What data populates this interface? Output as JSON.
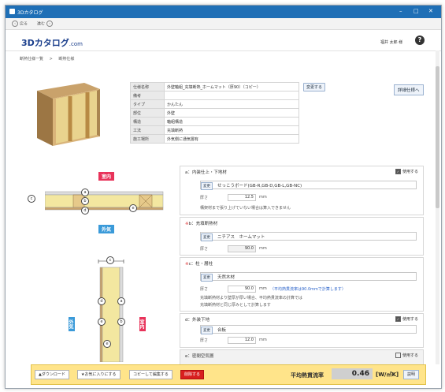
{
  "window": {
    "title": "3Dカタログ"
  },
  "nav": {
    "back": "戻る",
    "forward": "進む"
  },
  "header": {
    "logo_main": "3Dカタログ",
    "logo_com": ".com",
    "user": "福井 太郎 様",
    "help": "?"
  },
  "breadcrumb": {
    "items": [
      "断熱仕様一覧",
      ">",
      "断熱仕様"
    ]
  },
  "spec": {
    "rows": [
      {
        "k": "仕様名称",
        "v": "外壁軸組_充填断熱_ホームマット（厚90）（コピー）"
      },
      {
        "k": "備考",
        "v": ""
      },
      {
        "k": "タイプ",
        "v": "かんたん"
      },
      {
        "k": "部位",
        "v": "外壁"
      },
      {
        "k": "構造",
        "v": "軸組構造"
      },
      {
        "k": "工法",
        "v": "充填断熱"
      },
      {
        "k": "施工場所",
        "v": "外気側に通気層有"
      }
    ],
    "change_btn": "変更する",
    "detail_btn": "詳細仕様へ"
  },
  "diagram": {
    "indoor": "室内",
    "outdoor": "外気",
    "labels": {
      "a": "a",
      "b": "b",
      "c": "c",
      "d": "d",
      "e": "e"
    }
  },
  "layers": [
    {
      "hd": "a：内装仕上・下地材",
      "use": "使用する",
      "checked": true,
      "change": "変更",
      "material": "せっこうボード(GB-R,GB-D,GB-L,GB-NC)",
      "thick_label": "厚さ",
      "thickness": "12.5",
      "unit": "mm",
      "note1": "構架材まで張り上げていない場合は算入できません",
      "note2": ""
    },
    {
      "hd": "b：充填断熱材",
      "mark": "※",
      "use": "",
      "checked": true,
      "change": "変更",
      "material": "ニチアス　ホームマット",
      "thick_label": "厚さ",
      "thickness": "90.0",
      "unit": "mm",
      "note1": "",
      "note2": ""
    },
    {
      "hd": "c：柱・層柱",
      "mark": "※",
      "use": "",
      "checked": true,
      "change": "変更",
      "material": "天然木材",
      "thick_label": "厚さ",
      "thickness": "90.0",
      "unit": "mm",
      "unit_note": "（平均熱貫流率は90.0mmで計算します）",
      "note1": "充填断熱材より壁厚が厚い場合、平均熱貫流率の計算では",
      "note2": "充填断熱材と同じ厚みとして計算します"
    },
    {
      "hd": "d：外装下地",
      "use": "使用する",
      "checked": true,
      "change": "変更",
      "material": "合板",
      "thick_label": "厚さ",
      "thickness": "12.0",
      "unit": "mm",
      "note1": "",
      "note2": ""
    },
    {
      "hd": "e：密閉空気層",
      "use": "使用する",
      "checked": false,
      "change": "",
      "material": "",
      "thick_label": "",
      "thickness": "",
      "unit": "",
      "note1": "",
      "note2": ""
    }
  ],
  "footer": {
    "download": "▲ダウンロード",
    "favorite": "★お気に入りにする",
    "copy": "コピーして編集する",
    "delete": "削除する",
    "rate_label": "平均熱貫流率",
    "rate_value": "0.46",
    "rate_unit": "[W/㎡K]",
    "explain": "説明"
  },
  "colors": {
    "titlebar": "#1f6fb6",
    "indoor": "#e8335a",
    "outdoor": "#3a9ad9",
    "footer": "#ffe48a",
    "insulation": "#f3e7a0",
    "stud": "#e6c98a"
  }
}
